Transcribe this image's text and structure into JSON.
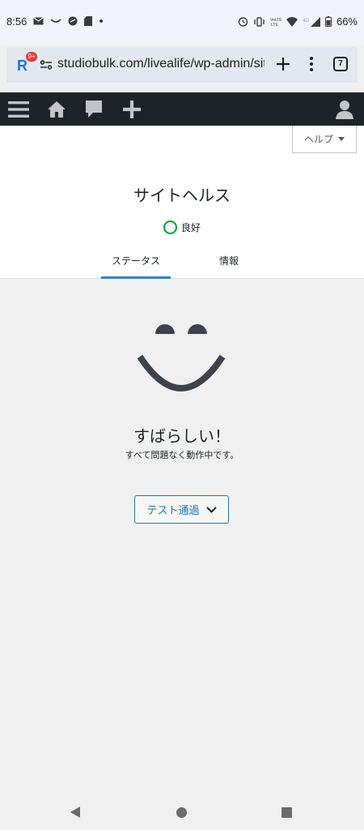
{
  "status_bar": {
    "time": "8:56",
    "battery": "66%",
    "notification_icons": [
      "mail-icon",
      "amazon-icon",
      "app-icon",
      "sd-card-icon",
      "dot-icon"
    ],
    "system_icons": [
      "alarm-icon",
      "vibrate-icon",
      "volte-icon",
      "wifi-icon",
      "signal-icon",
      "battery-icon"
    ]
  },
  "browser": {
    "url": "studiobulk.com/livealife/wp-admin/site",
    "app_badge": "9+",
    "app_letter": "R",
    "tab_count": "7"
  },
  "admin_bar": {
    "items": [
      "menu-icon",
      "home-icon",
      "comment-icon",
      "plus-icon",
      "user-icon"
    ]
  },
  "header": {
    "help_label": "ヘルプ",
    "title": "サイトヘルス",
    "health_status": "良好",
    "tabs": [
      {
        "label": "ステータス",
        "active": true
      },
      {
        "label": "情報",
        "active": false
      }
    ]
  },
  "main": {
    "heading": "すばらしい！",
    "subtext": "すべて問題なく動作中です。",
    "passed_button_label": "テスト通過"
  },
  "colors": {
    "admin_bar": "#1d2327",
    "accent": "#3582c4",
    "good": "#00a32a",
    "link": "#2271b1"
  }
}
